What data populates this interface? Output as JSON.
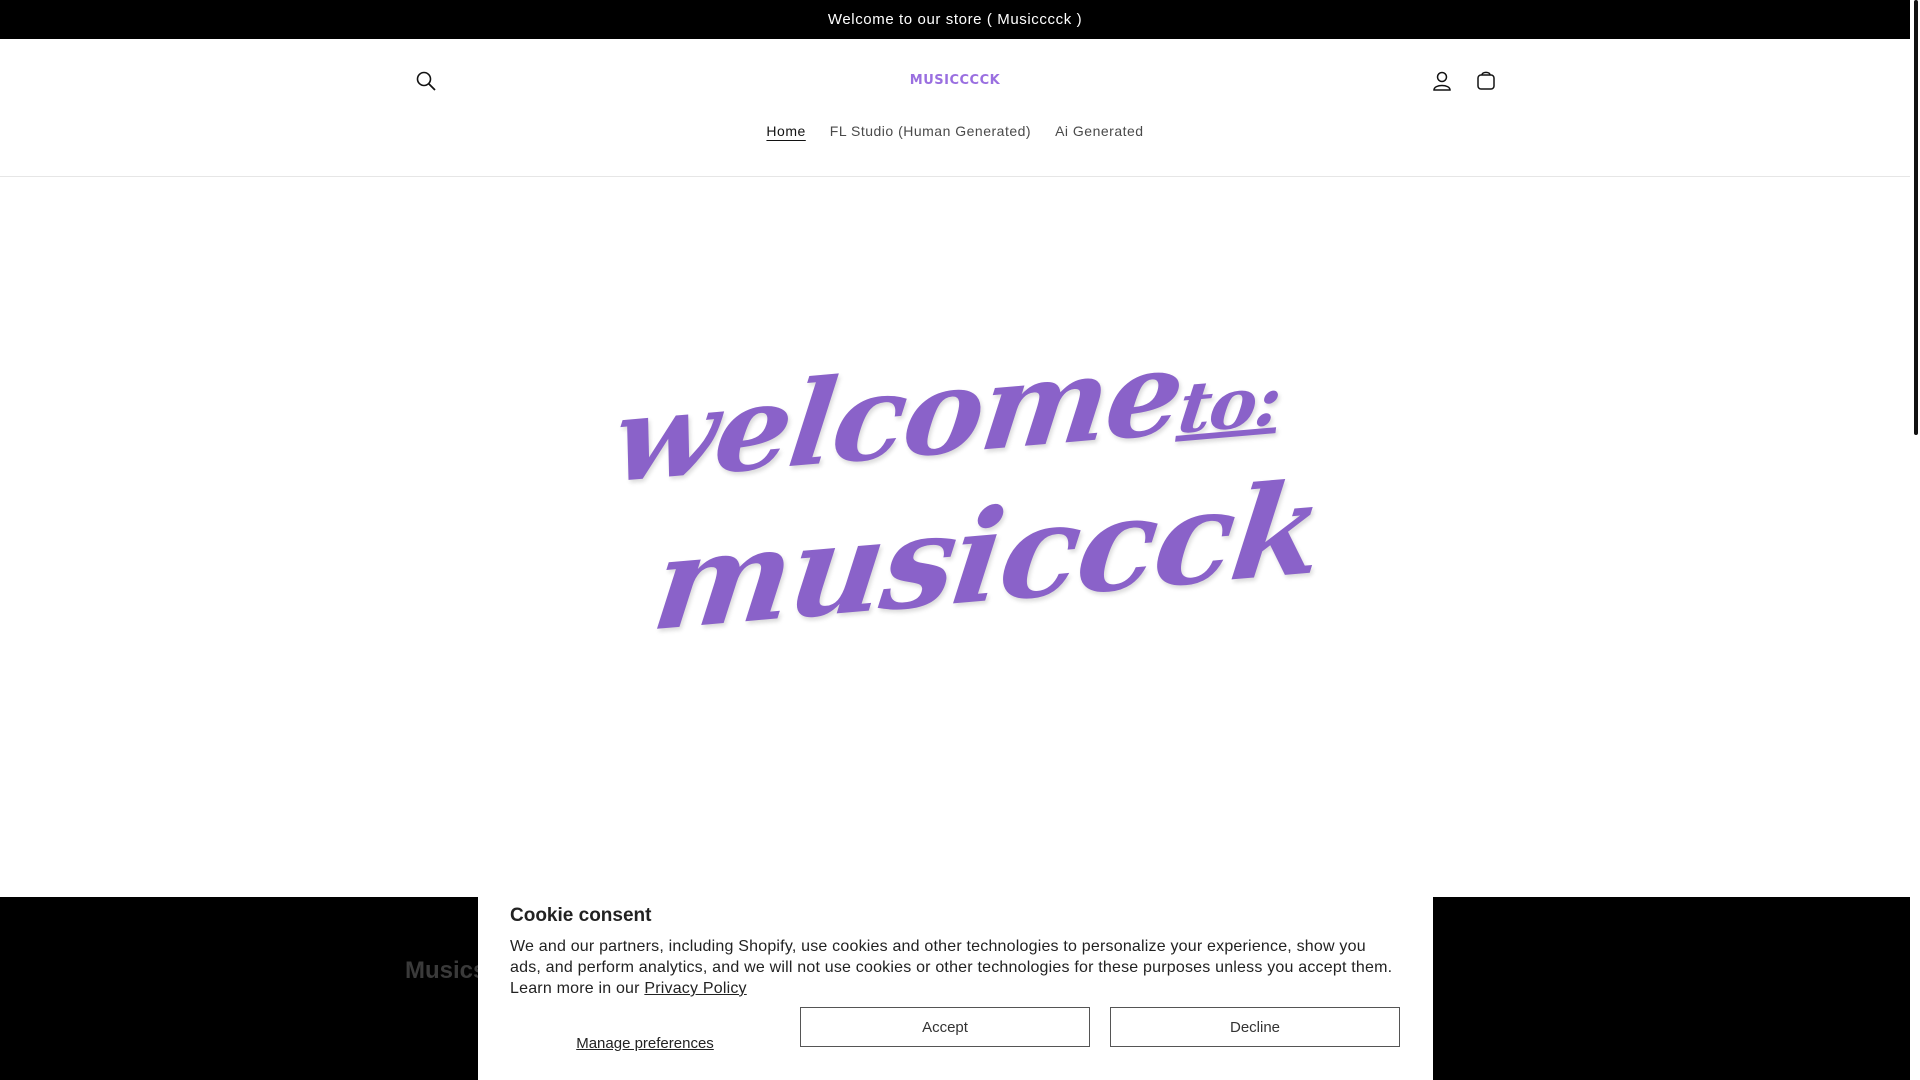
{
  "announcement": {
    "text": "Welcome to our store ( Musicccck )"
  },
  "header": {
    "logo_text": "MUSICCCCK",
    "nav": [
      {
        "label": "Home",
        "active": true
      },
      {
        "label": "FL Studio (Human Generated)",
        "active": false
      },
      {
        "label": "Ai Generated",
        "active": false
      }
    ],
    "icons": [
      "search-icon",
      "account-icon",
      "cart-icon"
    ]
  },
  "hero": {
    "line1": "welcome",
    "line1_small": "to:",
    "line2": "musiccck",
    "color": "#8a62c9"
  },
  "footer": {
    "heading": "Musics"
  },
  "cookie": {
    "title": "Cookie consent",
    "text": "We and our partners, including Shopify, use cookies and other technologies to personalize your experience, show you ads, and perform analytics, and we will not use cookies or other technologies for these purposes unless you accept them. Learn more in our",
    "policy_link": "Privacy Policy",
    "manage_label": "Manage preferences",
    "accept_label": "Accept",
    "decline_label": "Decline"
  }
}
